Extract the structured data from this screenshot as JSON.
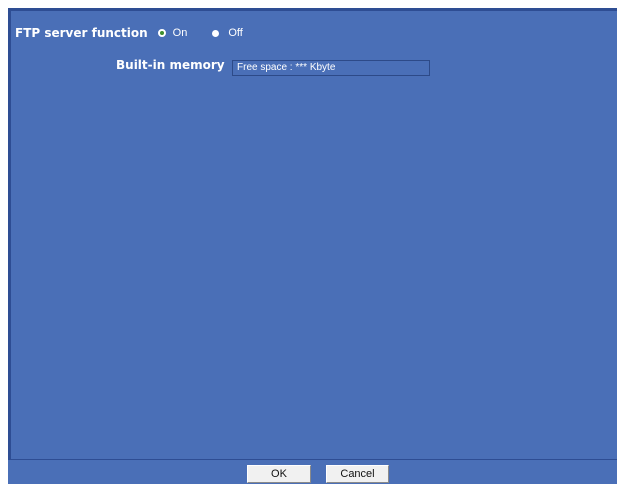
{
  "ftp": {
    "label": "FTP server function",
    "options": [
      {
        "label": "On",
        "selected": true
      },
      {
        "label": "Off",
        "selected": false
      }
    ]
  },
  "memory": {
    "label": "Built-in memory",
    "value": "Free space : *** Kbyte"
  },
  "buttons": {
    "ok": "OK",
    "cancel": "Cancel"
  },
  "colors": {
    "panel_bg": "#4a6fb7",
    "panel_border": "#2e4d93",
    "selected_radio_dot": "#3f8f2e"
  }
}
